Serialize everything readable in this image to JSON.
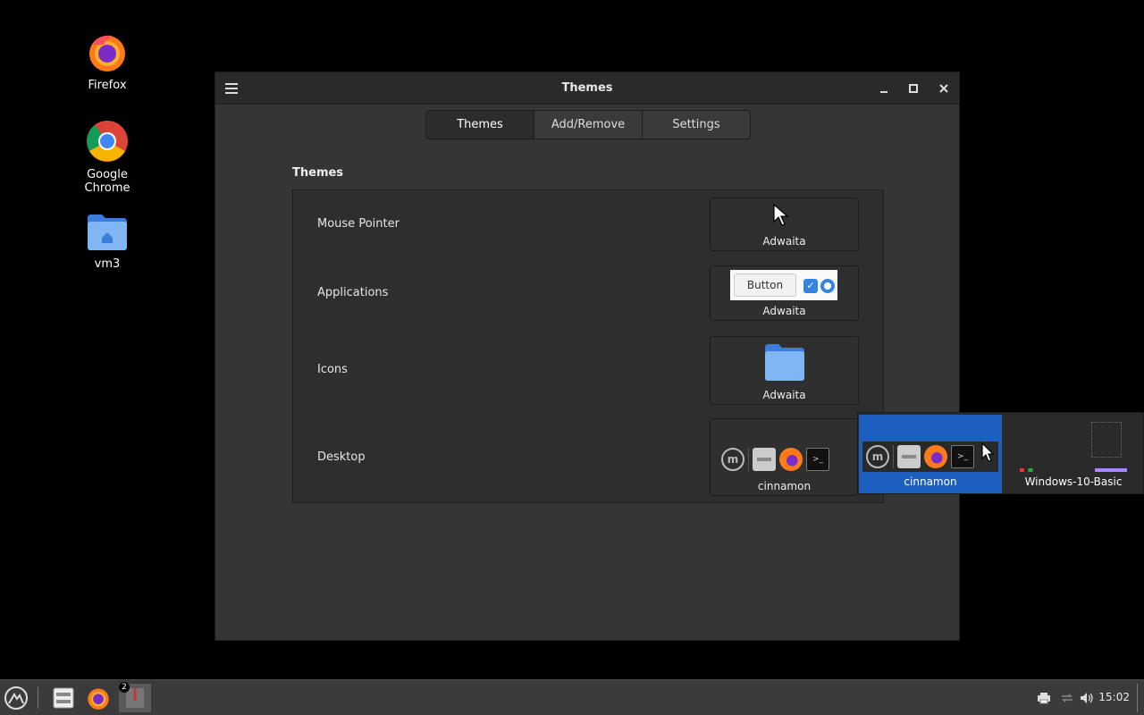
{
  "desktop": {
    "icons": [
      {
        "label": "Firefox",
        "icon": "firefox-icon"
      },
      {
        "label": "Google Chrome",
        "icon": "chrome-icon"
      },
      {
        "label": "vm3",
        "icon": "home-folder-icon"
      }
    ]
  },
  "window": {
    "title": "Themes",
    "tabs": [
      "Themes",
      "Add/Remove",
      "Settings"
    ],
    "active_tab": "Themes",
    "section_title": "Themes",
    "rows": [
      {
        "label": "Mouse Pointer",
        "value": "Adwaita"
      },
      {
        "label": "Applications",
        "value": "Adwaita",
        "preview_button": "Button"
      },
      {
        "label": "Icons",
        "value": "Adwaita"
      },
      {
        "label": "Desktop",
        "value": "cinnamon"
      }
    ]
  },
  "popup": {
    "items": [
      {
        "label": "cinnamon",
        "selected": true
      },
      {
        "label": "Windows-10-Basic",
        "selected": false
      }
    ]
  },
  "taskbar": {
    "clock": "15:02",
    "badge": "2"
  },
  "colors": {
    "selection": "#1d5fbf",
    "window_bg": "#353535",
    "folder_blue": "#4a8fe0"
  }
}
